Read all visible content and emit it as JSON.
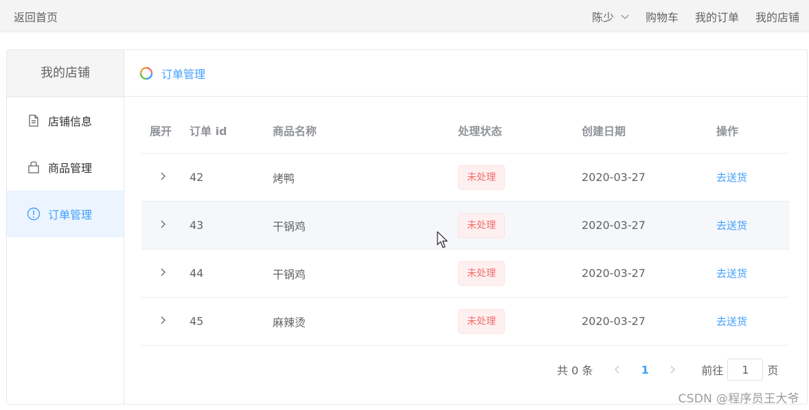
{
  "topbar": {
    "back_label": "返回首页",
    "user_label": "陈少",
    "cart_label": "购物车",
    "orders_label": "我的订单",
    "store_label": "我的店铺"
  },
  "sidebar": {
    "title": "我的店铺",
    "items": [
      {
        "label": "店铺信息",
        "icon": "document-icon",
        "active": false
      },
      {
        "label": "商品管理",
        "icon": "shopping-bag-icon",
        "active": false
      },
      {
        "label": "订单管理",
        "icon": "warning-circle-icon",
        "active": true
      }
    ]
  },
  "content": {
    "title": "订单管理",
    "title_icon": "loading-spinner-icon",
    "accent_color": "#409eff"
  },
  "table": {
    "columns": [
      "展开",
      "订单 id",
      "商品名称",
      "处理状态",
      "创建日期",
      "操作"
    ],
    "rows": [
      {
        "id": "42",
        "name": "烤鸭",
        "status": "未处理",
        "date": "2020-03-27",
        "action": "去送货"
      },
      {
        "id": "43",
        "name": "干锅鸡",
        "status": "未处理",
        "date": "2020-03-27",
        "action": "去送货"
      },
      {
        "id": "44",
        "name": "干锅鸡",
        "status": "未处理",
        "date": "2020-03-27",
        "action": "去送货"
      },
      {
        "id": "45",
        "name": "麻辣烫",
        "status": "未处理",
        "date": "2020-03-27",
        "action": "去送货"
      }
    ],
    "status_color": "#f56c6c"
  },
  "pagination": {
    "total_label": "共 0 条",
    "current_page": "1",
    "goto_label": "前往",
    "goto_value": "1",
    "page_suffix": "页"
  },
  "watermark": "CSDN @程序员王大爷"
}
